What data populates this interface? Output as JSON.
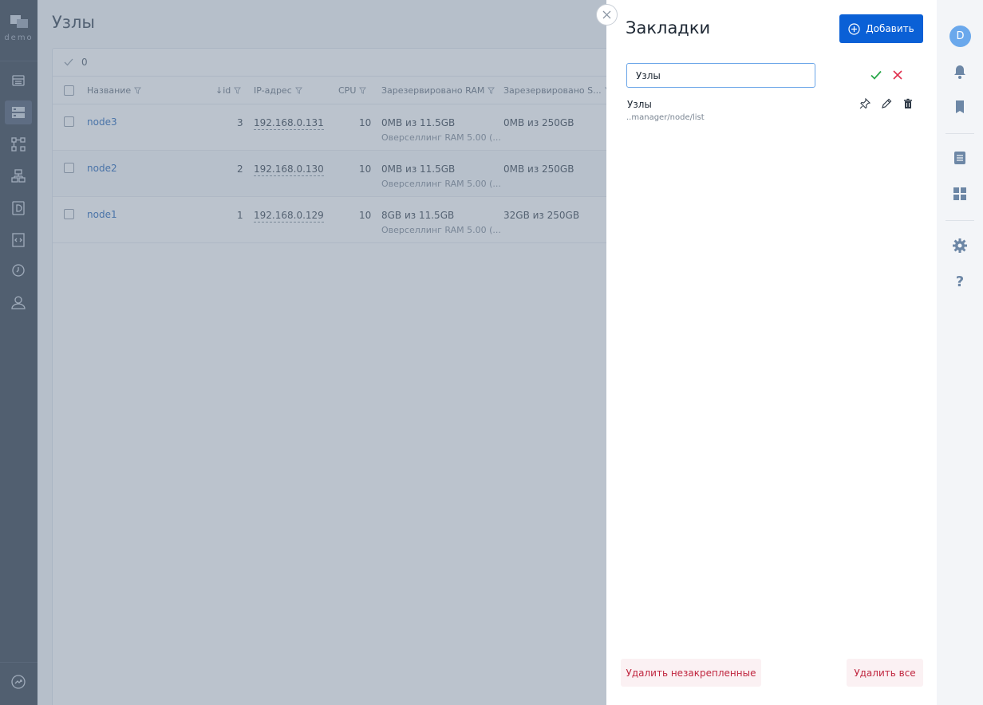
{
  "app": {
    "env_label": "demo"
  },
  "page": {
    "title": "Узлы"
  },
  "toolbar": {
    "selected_count": "0"
  },
  "table": {
    "columns": {
      "name": "Название",
      "id": "↓id",
      "ip": "IP-адрес",
      "cpu": "CPU",
      "ram": "Зарезервировано RAM",
      "storage": "Зарезервировано S..."
    },
    "rows": [
      {
        "name": "node3",
        "id": "3",
        "ip": "192.168.0.131",
        "cpu": "10",
        "ram": "0MB из 11.5GB",
        "ram_note": "Оверселлинг RAM 5.00 (...",
        "storage": "0MB из 250GB"
      },
      {
        "name": "node2",
        "id": "2",
        "ip": "192.168.0.130",
        "cpu": "10",
        "ram": "0MB из 11.5GB",
        "ram_note": "Оверселлинг RAM 5.00 (...",
        "storage": "0MB из 250GB"
      },
      {
        "name": "node1",
        "id": "1",
        "ip": "192.168.0.129",
        "cpu": "10",
        "ram": "8GB из 11.5GB",
        "ram_note": "Оверселлинг RAM 5.00 (...",
        "storage": "32GB из 250GB"
      }
    ]
  },
  "bookmarks": {
    "title": "Закладки",
    "add_label": "Добавить",
    "input_value": "Узлы",
    "items": [
      {
        "title": "Узлы",
        "url": "..manager/node/list"
      }
    ],
    "delete_unpinned_label": "Удалить незакрепленные",
    "delete_all_label": "Удалить все"
  },
  "user": {
    "avatar_letter": "D"
  },
  "colors": {
    "primary": "#0a60d6",
    "confirm": "#2aa84a",
    "danger": "#e0304e",
    "sidebar": "#2b3645"
  }
}
